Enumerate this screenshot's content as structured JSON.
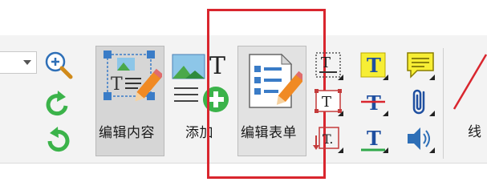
{
  "ribbon": {
    "edit_content_label": "编辑内容",
    "add_label": "添加",
    "edit_form_label": "编辑表单",
    "line_label_partial": "线"
  },
  "icons": {
    "zoom": "zoom-in-icon",
    "rotate_cw": "rotate-clockwise-icon",
    "rotate_ccw": "rotate-counterclockwise-icon",
    "edit_content": "edit-content-icon",
    "add": "add-image-text-icon",
    "edit_form": "edit-form-icon",
    "text_box": "text-box-icon",
    "text_field": "text-field-icon",
    "text_small": "text-small-icon",
    "highlight_text": "highlight-text-icon",
    "strikeout_text": "strikeout-text-icon",
    "underline_text": "underline-text-icon",
    "comment": "comment-note-icon",
    "attachment": "attachment-icon",
    "sound": "sound-icon",
    "line": "line-icon"
  },
  "colors": {
    "highlight_box": "#d9262e",
    "accent_green": "#3bb34a",
    "accent_orange": "#f08a24"
  }
}
